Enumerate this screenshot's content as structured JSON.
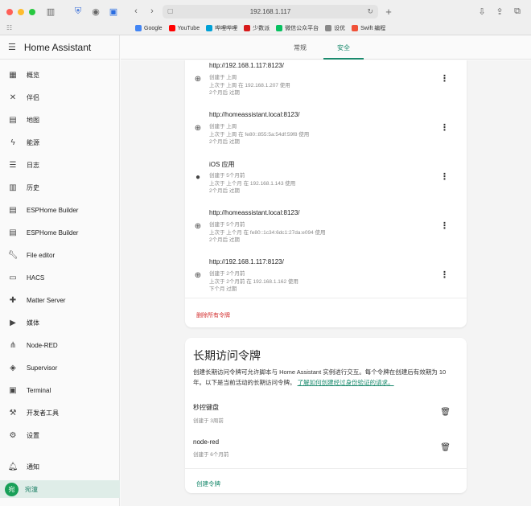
{
  "browser": {
    "url": "192.168.1.117",
    "bookmarks": [
      {
        "label": "Google",
        "color": "#4285f4"
      },
      {
        "label": "YouTube",
        "color": "#ff0000"
      },
      {
        "label": "哔哩哔哩",
        "color": "#00a1d6"
      },
      {
        "label": "少数派",
        "color": "#d71a1b"
      },
      {
        "label": "微信公众平台",
        "color": "#07c160"
      },
      {
        "label": "设优",
        "color": "#888888"
      },
      {
        "label": "Swift 编程",
        "color": "#f05138"
      }
    ]
  },
  "sidebar": {
    "brand": "Home Assistant",
    "items": [
      {
        "label": "概览",
        "icon": "dashboard-icon"
      },
      {
        "label": "伴侣",
        "icon": "tools-icon"
      },
      {
        "label": "地图",
        "icon": "map-icon"
      },
      {
        "label": "能源",
        "icon": "lightning-icon"
      },
      {
        "label": "日志",
        "icon": "list-icon"
      },
      {
        "label": "历史",
        "icon": "chart-icon"
      },
      {
        "label": "ESPHome Builder",
        "icon": "esphome-icon"
      },
      {
        "label": "ESPHome Builder",
        "icon": "esphome-icon"
      },
      {
        "label": "File editor",
        "icon": "wrench-icon"
      },
      {
        "label": "HACS",
        "icon": "hacs-icon"
      },
      {
        "label": "Matter Server",
        "icon": "puzzle-icon"
      },
      {
        "label": "媒体",
        "icon": "play-icon"
      },
      {
        "label": "Node-RED",
        "icon": "sitemap-icon"
      },
      {
        "label": "Supervisor",
        "icon": "supervisor-icon"
      },
      {
        "label": "Terminal",
        "icon": "terminal-icon"
      },
      {
        "label": "开发者工具",
        "icon": "hammer-icon"
      },
      {
        "label": "设置",
        "icon": "gear-icon"
      }
    ],
    "notifications": "通知",
    "user": {
      "name": "宛潼",
      "initial": "宛"
    }
  },
  "tabs": [
    {
      "label": "常规"
    },
    {
      "label": "安全"
    }
  ],
  "refresh_tokens": [
    {
      "title": "http://192.168.1.117:8123/",
      "created": "创建于 上周",
      "last_used": "上次于 上周 在 192.168.1.207 使用",
      "expires": "2个月后 过期",
      "icon": "globe-icon"
    },
    {
      "title": "http://homeassistant.local:8123/",
      "created": "创建于 上周",
      "last_used": "上次于 上周 在 fe80::855:5a:54df:59f8 使用",
      "expires": "2个月后 过期",
      "icon": "globe-icon"
    },
    {
      "title": "iOS 应用",
      "created": "创建于 5个月前",
      "last_used": "上次于 上个月 在 192.168.1.143 使用",
      "expires": "2个月后 过期",
      "icon": "apple-icon"
    },
    {
      "title": "http://homeassistant.local:8123/",
      "created": "创建于 5个月前",
      "last_used": "上次于 上个月 在 fe80::1c34:6dc1:27da:e094 使用",
      "expires": "2个月后 过期",
      "icon": "globe-icon"
    },
    {
      "title": "http://192.168.1.117:8123/",
      "created": "创建于 2个月前",
      "last_used": "上次于 2个月前 在 192.168.1.162 使用",
      "expires": "下个月 过期",
      "icon": "globe-icon"
    }
  ],
  "delete_all_label": "删除所有令牌",
  "long_lived": {
    "title": "长期访问令牌",
    "desc": "创建长期访问令牌可允许脚本与 Home Assistant 实例进行交互。每个令牌在创建后有效期为 10 年。以下是当前活动的长期访问令牌。",
    "link": "了解如何创建经过身份验证的请求。",
    "tokens": [
      {
        "name": "秒控键盘",
        "created": "创建于 3周前"
      },
      {
        "name": "node-red",
        "created": "创建于 6个月前"
      }
    ],
    "create_label": "创建令牌"
  }
}
